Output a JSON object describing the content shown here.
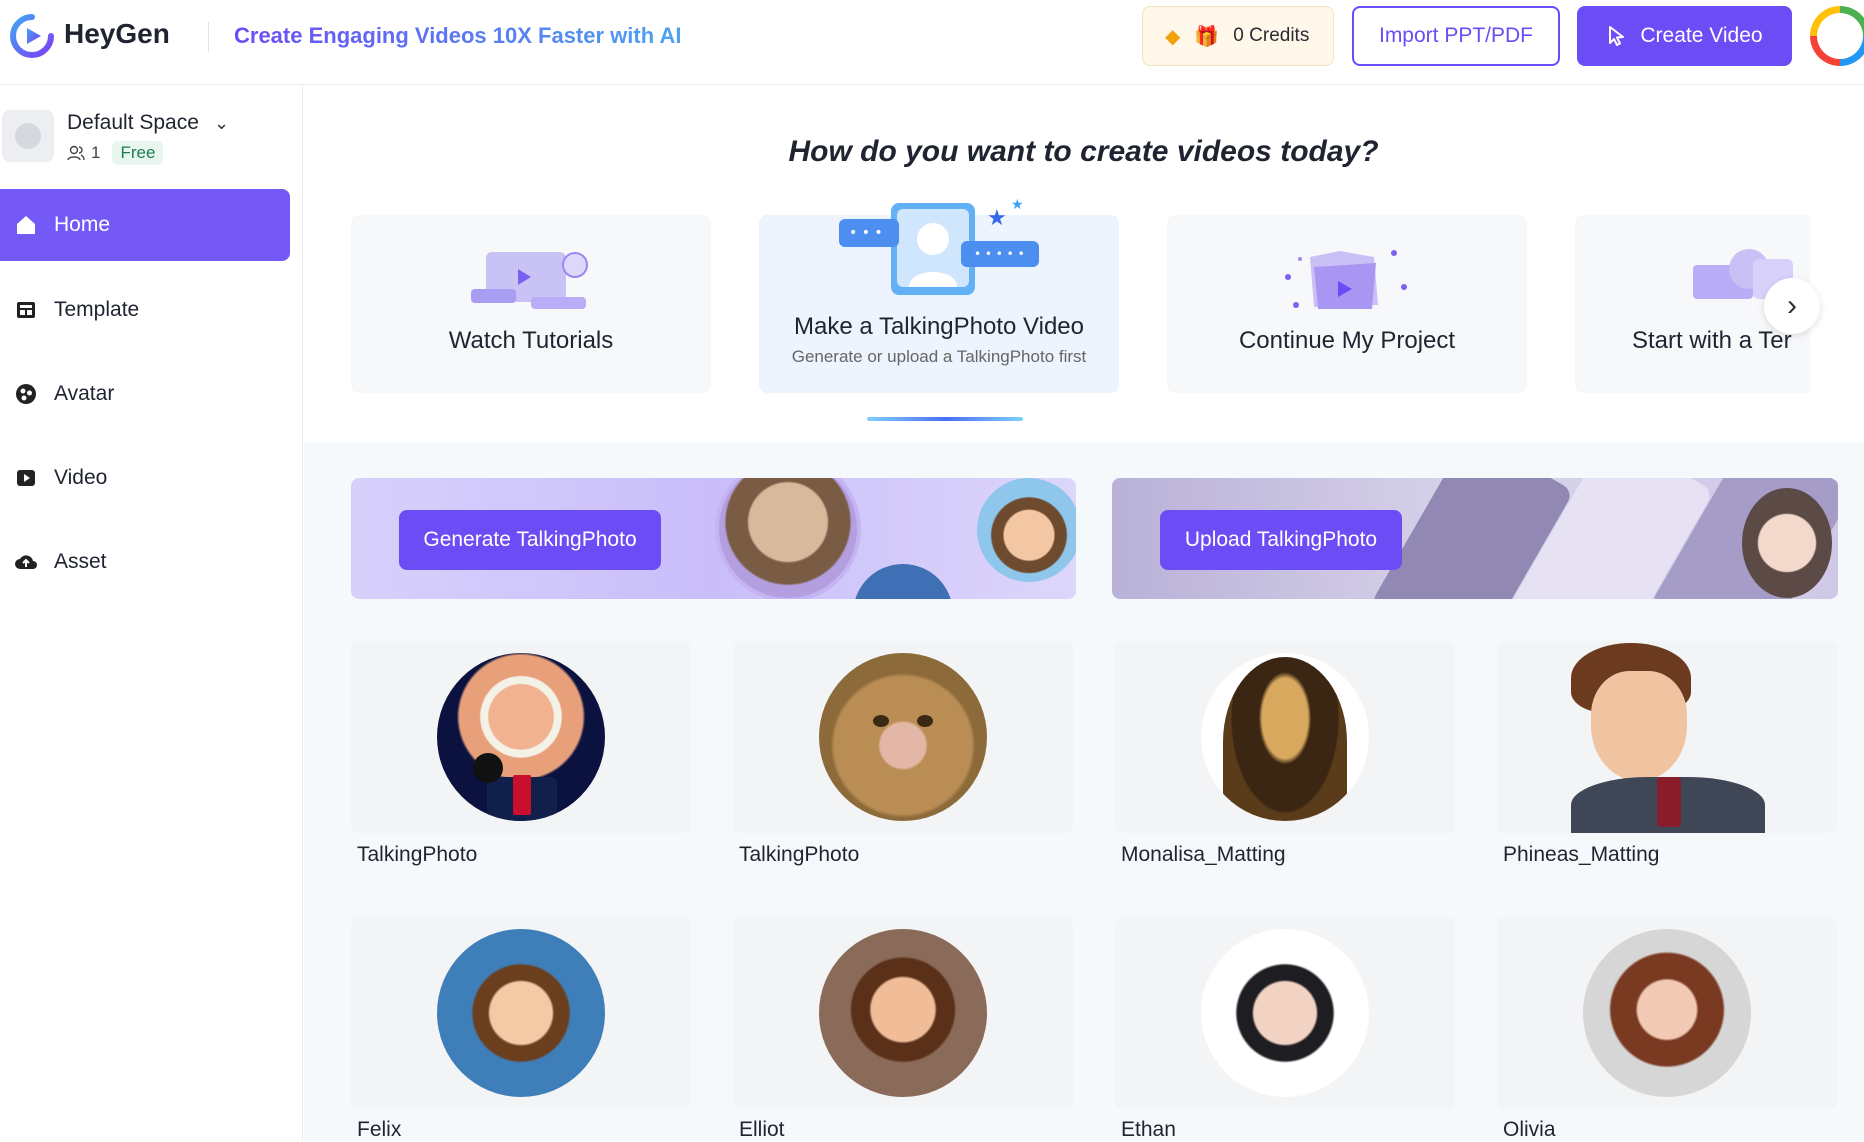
{
  "header": {
    "brand": "HeyGen",
    "tagline": "Create Engaging Videos 10X Faster with AI",
    "credits": "0 Credits",
    "import_label": "Import PPT/PDF",
    "create_label": "Create Video",
    "colors": {
      "accent": "#6b4cf5"
    }
  },
  "sidebar": {
    "space_name": "Default Space",
    "member_count": "1",
    "plan": "Free",
    "items": [
      {
        "label": "Home",
        "icon": "home-icon",
        "active": true
      },
      {
        "label": "Template",
        "icon": "template-icon"
      },
      {
        "label": "Avatar",
        "icon": "avatar-icon"
      },
      {
        "label": "Video",
        "icon": "video-icon"
      },
      {
        "label": "Asset",
        "icon": "cloud-upload-icon"
      }
    ]
  },
  "main": {
    "heading": "How do you want to create videos today?",
    "cards": [
      {
        "title": "Watch Tutorials"
      },
      {
        "title": "Make a TalkingPhoto Video",
        "subtitle": "Generate or upload a TalkingPhoto first"
      },
      {
        "title": "Continue My Project"
      },
      {
        "title": "Start with a Ter"
      }
    ],
    "generate_label": "Generate TalkingPhoto",
    "upload_label": "Upload TalkingPhoto",
    "photos": [
      {
        "name": "TalkingPhoto"
      },
      {
        "name": "TalkingPhoto"
      },
      {
        "name": "Monalisa_Matting"
      },
      {
        "name": "Phineas_Matting"
      },
      {
        "name": "Felix"
      },
      {
        "name": "Elliot"
      },
      {
        "name": "Ethan"
      },
      {
        "name": "Olivia"
      }
    ]
  }
}
